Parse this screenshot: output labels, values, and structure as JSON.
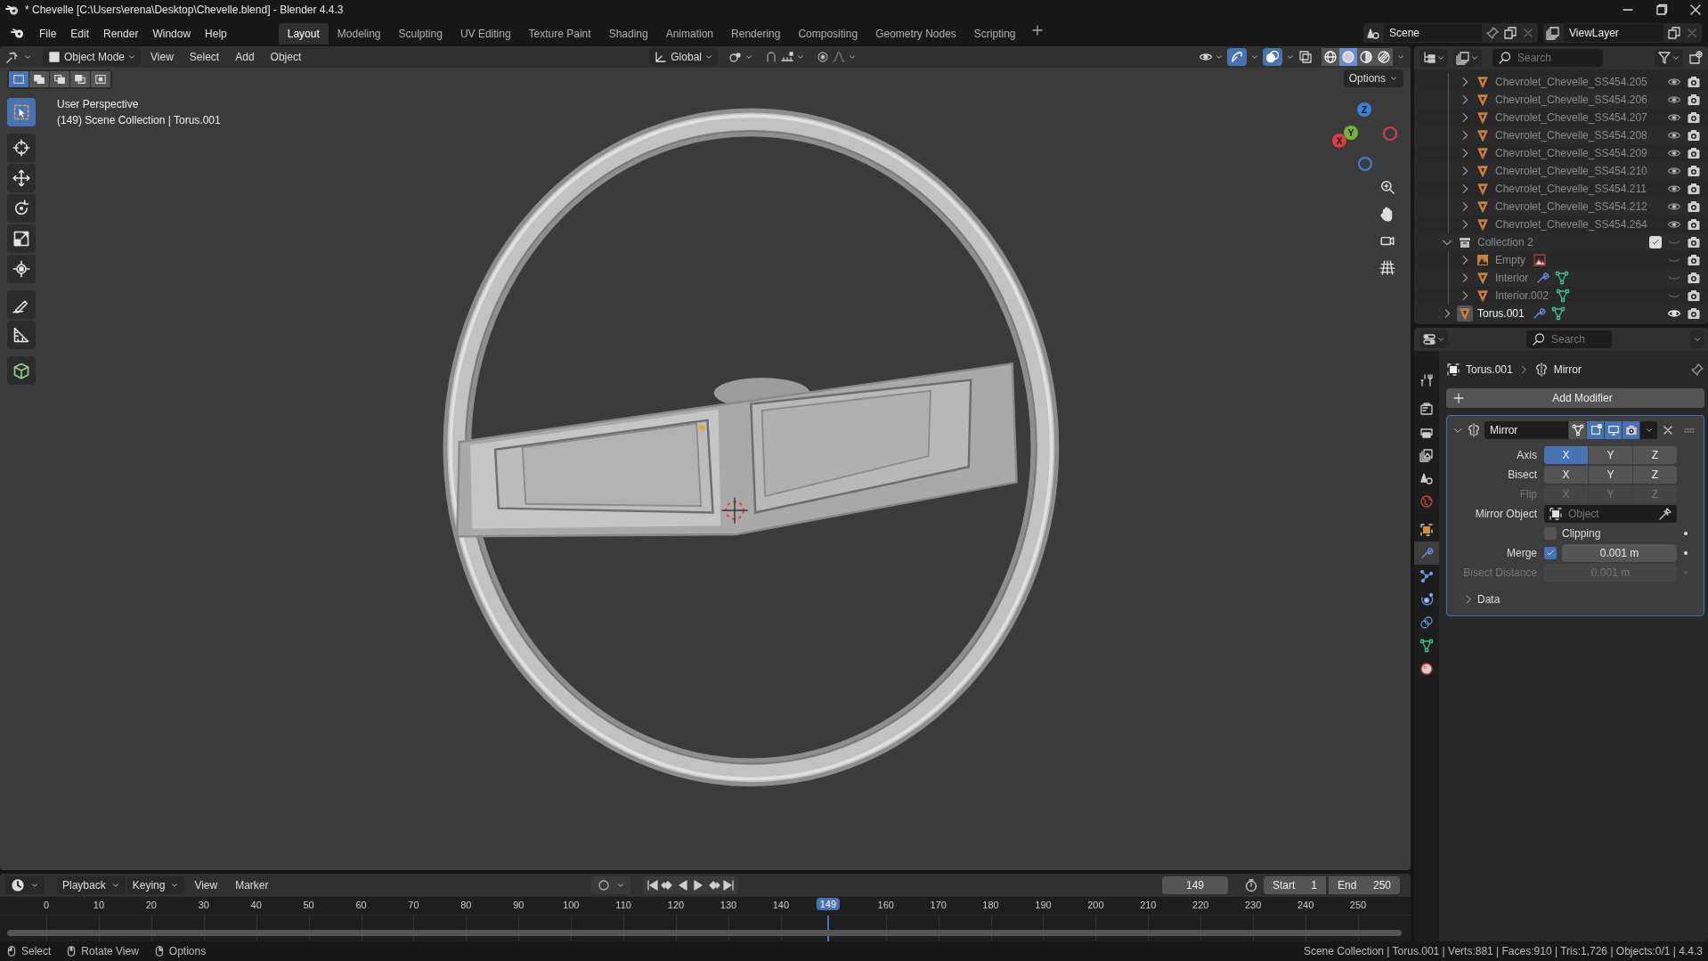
{
  "window": {
    "title": "* Chevelle [C:\\Users\\erena\\Desktop\\Chevelle.blend] - Blender 4.4.3"
  },
  "menu": [
    "File",
    "Edit",
    "Render",
    "Window",
    "Help"
  ],
  "workspaces": [
    {
      "label": "Layout",
      "selected": true
    },
    {
      "label": "Modeling",
      "selected": false
    },
    {
      "label": "Sculpting",
      "selected": false
    },
    {
      "label": "UV Editing",
      "selected": false
    },
    {
      "label": "Texture Paint",
      "selected": false
    },
    {
      "label": "Shading",
      "selected": false
    },
    {
      "label": "Animation",
      "selected": false
    },
    {
      "label": "Rendering",
      "selected": false
    },
    {
      "label": "Compositing",
      "selected": false
    },
    {
      "label": "Geometry Nodes",
      "selected": false
    },
    {
      "label": "Scripting",
      "selected": false
    }
  ],
  "scene": {
    "name": "Scene"
  },
  "view_layer": {
    "name": "ViewLayer"
  },
  "viewport": {
    "mode": "Object Mode",
    "menus": [
      "View",
      "Select",
      "Add",
      "Object"
    ],
    "orientation": "Global",
    "options_button": "Options",
    "overlay_text": [
      "User Perspective",
      "(149) Scene Collection | Torus.001"
    ],
    "select_modes": [
      {
        "selected": true
      },
      {
        "selected": false
      },
      {
        "selected": false
      },
      {
        "selected": false
      },
      {
        "selected": false
      }
    ],
    "tools": [
      {
        "kind": "select",
        "selected": true
      },
      {
        "kind": "cursor",
        "selected": false
      },
      {
        "kind": "move",
        "selected": false
      },
      {
        "kind": "rotate",
        "selected": false
      },
      {
        "kind": "scale",
        "selected": false
      },
      {
        "kind": "transform",
        "selected": false
      },
      {
        "kind": "annotate",
        "selected": false
      },
      {
        "kind": "measure",
        "selected": false
      },
      {
        "kind": "add_cube",
        "selected": false
      }
    ],
    "gizmos_on": true,
    "overlays_on": true,
    "shading": [
      {
        "kind": "wireframe",
        "selected": false
      },
      {
        "kind": "solid",
        "selected": true
      },
      {
        "kind": "material",
        "selected": false
      },
      {
        "kind": "rendered",
        "selected": false
      }
    ],
    "gizmo_axes": [
      "X",
      "Y",
      "Z"
    ]
  },
  "outliner": {
    "search_placeholder": "Search",
    "tree": [
      {
        "children": [
          {
            "name": "Chevrolet_Chevelle_SS454.205",
            "kind": "mesh",
            "expanded": false,
            "visible": true,
            "selected": false
          },
          {
            "name": "Chevrolet_Chevelle_SS454.206",
            "kind": "mesh",
            "expanded": false,
            "visible": true,
            "selected": false
          },
          {
            "name": "Chevrolet_Chevelle_SS454.207",
            "kind": "mesh",
            "expanded": false,
            "visible": true,
            "selected": false
          },
          {
            "name": "Chevrolet_Chevelle_SS454.208",
            "kind": "mesh",
            "expanded": false,
            "visible": true,
            "selected": false
          },
          {
            "name": "Chevrolet_Chevelle_SS454.209",
            "kind": "mesh",
            "expanded": false,
            "visible": true,
            "selected": false
          },
          {
            "name": "Chevrolet_Chevelle_SS454.210",
            "kind": "mesh",
            "expanded": false,
            "visible": true,
            "selected": false
          },
          {
            "name": "Chevrolet_Chevelle_SS454.211",
            "kind": "mesh",
            "expanded": false,
            "visible": true,
            "selected": false
          },
          {
            "name": "Chevrolet_Chevelle_SS454.212",
            "kind": "mesh",
            "expanded": false,
            "visible": true,
            "selected": false
          },
          {
            "name": "Chevrolet_Chevelle_SS454.264",
            "kind": "mesh",
            "expanded": false,
            "visible": true,
            "selected": false
          }
        ]
      },
      {
        "name": "Collection 2",
        "kind": "collection",
        "expanded": true,
        "checked": true,
        "visible": false,
        "selected": false,
        "children": [
          {
            "name": "Empty",
            "kind": "image_empty",
            "expanded": false,
            "visible": false,
            "selected": false,
            "badges": [
              {
                "kind": "image"
              }
            ]
          },
          {
            "name": "Interior",
            "kind": "mesh",
            "expanded": false,
            "visible": false,
            "selected": false,
            "badges": [
              {
                "kind": "modifier"
              },
              {
                "kind": "mesh_data"
              }
            ]
          },
          {
            "name": "Interior.002",
            "kind": "mesh",
            "expanded": false,
            "visible": false,
            "selected": false,
            "badges": [
              {
                "kind": "mesh_data"
              }
            ]
          }
        ]
      },
      {
        "name": "Torus.001",
        "kind": "mesh",
        "expanded": false,
        "visible": true,
        "selected": true,
        "badges": [
          {
            "kind": "modifier"
          },
          {
            "kind": "mesh_data"
          }
        ]
      }
    ]
  },
  "properties": {
    "search_placeholder": "Search",
    "tabs": [
      {
        "kind": "tool",
        "selected": false
      },
      {
        "kind": "render",
        "selected": false
      },
      {
        "kind": "output",
        "selected": false
      },
      {
        "kind": "view_layer",
        "selected": false
      },
      {
        "kind": "scene",
        "selected": false
      },
      {
        "kind": "world",
        "selected": false
      },
      {
        "kind": "object",
        "selected": false
      },
      {
        "kind": "modifiers",
        "selected": true
      },
      {
        "kind": "particles",
        "selected": false
      },
      {
        "kind": "physics",
        "selected": false
      },
      {
        "kind": "constraints",
        "selected": false
      },
      {
        "kind": "data",
        "selected": false
      },
      {
        "kind": "material",
        "selected": false
      }
    ],
    "breadcrumb": [
      "Torus.001",
      "Mirror"
    ],
    "add_button": "Add Modifier",
    "modifier": {
      "name": "Mirror",
      "expanded": true,
      "toggles": [
        {
          "kind": "edit_mode",
          "on": false
        },
        {
          "kind": "cage",
          "on": true
        },
        {
          "kind": "viewport",
          "on": true
        },
        {
          "kind": "render",
          "on": true
        }
      ],
      "rows": [
        {
          "kind": "axes",
          "label": "Axis",
          "disabled": false,
          "buttons": [
            {
              "label": "X",
              "selected": true
            },
            {
              "label": "Y",
              "selected": false
            },
            {
              "label": "Z",
              "selected": false
            }
          ]
        },
        {
          "kind": "axes",
          "label": "Bisect",
          "disabled": false,
          "buttons": [
            {
              "label": "X",
              "selected": false
            },
            {
              "label": "Y",
              "selected": false
            },
            {
              "label": "Z",
              "selected": false
            }
          ]
        },
        {
          "kind": "axes",
          "label": "Flip",
          "disabled": true,
          "buttons": [
            {
              "label": "X",
              "selected": false
            },
            {
              "label": "Y",
              "selected": false
            },
            {
              "label": "Z",
              "selected": false
            }
          ]
        },
        {
          "kind": "object",
          "label": "Mirror Object",
          "placeholder": "Object"
        },
        {
          "kind": "checkbox",
          "label": "Clipping",
          "checked": false
        },
        {
          "kind": "check_value",
          "label": "Merge",
          "checked": true,
          "value": "0.001 m"
        },
        {
          "kind": "value",
          "label": "Bisect Distance",
          "value": "0.001 m",
          "disabled": true
        }
      ],
      "subpanels": [
        {
          "label": "Data",
          "expanded": false
        }
      ]
    }
  },
  "timeline": {
    "menus": [
      {
        "label": "Playback",
        "dropdown": true
      },
      {
        "label": "Keying",
        "dropdown": true
      },
      {
        "label": "View",
        "dropdown": false
      },
      {
        "label": "Marker",
        "dropdown": false
      }
    ],
    "current_frame": "149",
    "start_label": "Start",
    "start": "1",
    "end_label": "End",
    "end": "250",
    "playhead": "149",
    "ticks": [
      "0",
      "10",
      "20",
      "30",
      "40",
      "50",
      "60",
      "70",
      "80",
      "90",
      "100",
      "110",
      "120",
      "130",
      "140",
      "160",
      "170",
      "180",
      "190",
      "200",
      "210",
      "220",
      "230",
      "240",
      "250"
    ]
  },
  "status_bar": {
    "hints": [
      "Select",
      "Rotate View",
      "Options"
    ],
    "stats": "Scene Collection | Torus.001 | Verts:881 | Faces:910 | Tris:1,726 | Objects:0/1 | 4.4.3"
  }
}
